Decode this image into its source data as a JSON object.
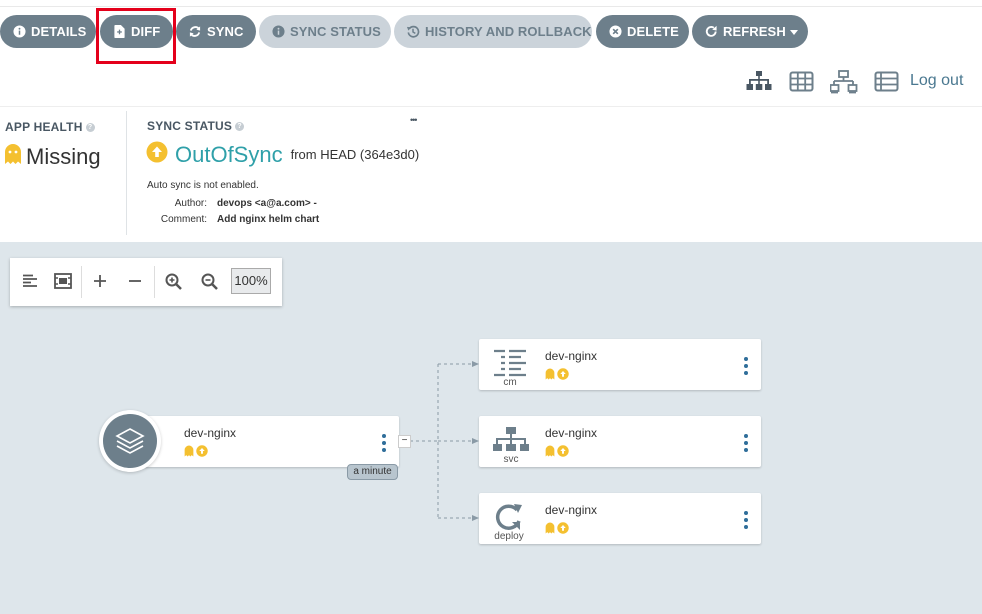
{
  "toolbar": {
    "details": "DETAILS",
    "diff": "DIFF",
    "sync": "SYNC",
    "sync_status": "SYNC STATUS",
    "history": "HISTORY AND ROLLBACK",
    "delete": "DELETE",
    "refresh": "REFRESH"
  },
  "header": {
    "logout": "Log out"
  },
  "app_health": {
    "label": "APP HEALTH",
    "value": "Missing"
  },
  "sync_status": {
    "label": "SYNC STATUS",
    "value": "OutOfSync",
    "from": "from HEAD (364e3d0)",
    "auto_sync": "Auto sync is not enabled.",
    "author_label": "Author:",
    "author": "devops <a@a.com> -",
    "comment_label": "Comment:",
    "comment": "Add nginx helm chart",
    "more": "•••"
  },
  "zoom": {
    "level": "100%"
  },
  "graph": {
    "root": {
      "name": "dev-nginx",
      "age": "a minute",
      "collapse": "−"
    },
    "children": [
      {
        "name": "dev-nginx",
        "kind": "cm"
      },
      {
        "name": "dev-nginx",
        "kind": "svc"
      },
      {
        "name": "dev-nginx",
        "kind": "deploy"
      }
    ]
  },
  "colors": {
    "button": "#6d7f8b",
    "button_disabled": "#cbd3da",
    "accent": "#2fa0a9",
    "warning": "#f4c030",
    "highlight": "#e4001b",
    "canvas": "#dee6eb"
  }
}
